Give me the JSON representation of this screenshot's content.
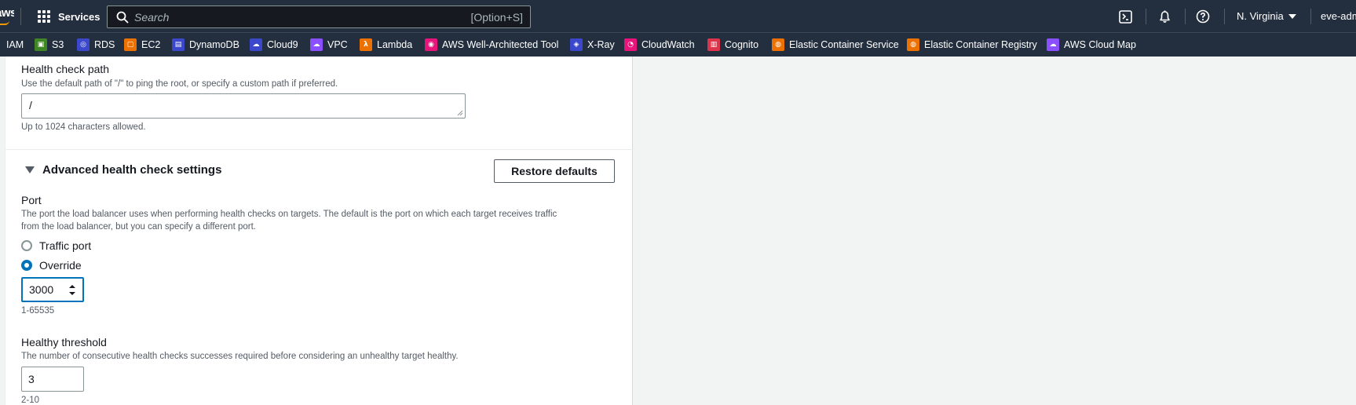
{
  "topnav": {
    "logo_text": "aws",
    "services_label": "Services",
    "search_placeholder": "Search",
    "search_shortcut": "[Option+S]",
    "region_label": "N. Virginia",
    "account_label": "eve-adm"
  },
  "favorites": [
    {
      "label": "IAM",
      "icon": "iam-icon",
      "color": "#dd344c"
    },
    {
      "label": "S3",
      "icon": "s3-icon",
      "color": "#3f8624"
    },
    {
      "label": "RDS",
      "icon": "rds-icon",
      "color": "#3b48cc"
    },
    {
      "label": "EC2",
      "icon": "ec2-icon",
      "color": "#ed7100"
    },
    {
      "label": "DynamoDB",
      "icon": "dynamodb-icon",
      "color": "#3b48cc"
    },
    {
      "label": "Cloud9",
      "icon": "cloud9-icon",
      "color": "#3b48cc"
    },
    {
      "label": "VPC",
      "icon": "vpc-icon",
      "color": "#8c4fff"
    },
    {
      "label": "Lambda",
      "icon": "lambda-icon",
      "color": "#ed7100"
    },
    {
      "label": "AWS Well-Architected Tool",
      "icon": "well-architected-icon",
      "color": "#e7157b"
    },
    {
      "label": "X-Ray",
      "icon": "xray-icon",
      "color": "#3b48cc"
    },
    {
      "label": "CloudWatch",
      "icon": "cloudwatch-icon",
      "color": "#e7157b"
    },
    {
      "label": "Cognito",
      "icon": "cognito-icon",
      "color": "#dd344c"
    },
    {
      "label": "Elastic Container Service",
      "icon": "ecs-icon",
      "color": "#ed7100"
    },
    {
      "label": "Elastic Container Registry",
      "icon": "ecr-icon",
      "color": "#ed7100"
    },
    {
      "label": "AWS Cloud Map",
      "icon": "cloud-map-icon",
      "color": "#8c4fff"
    }
  ],
  "health_check_path": {
    "label": "Health check path",
    "description": "Use the default path of \"/\" to ping the root, or specify a custom path if preferred.",
    "value": "/",
    "constraint": "Up to 1024 characters allowed."
  },
  "advanced": {
    "title": "Advanced health check settings",
    "restore_label": "Restore defaults"
  },
  "port": {
    "label": "Port",
    "description_line1": "The port the load balancer uses when performing health checks on targets. The default is the port on which each target receives traffic",
    "description_line2": "from the load balancer, but you can specify a different port.",
    "options": [
      {
        "label": "Traffic port",
        "checked": false
      },
      {
        "label": "Override",
        "checked": true
      }
    ],
    "value": "3000",
    "constraint": "1-65535"
  },
  "healthy_threshold": {
    "label": "Healthy threshold",
    "description": "The number of consecutive health checks successes required before considering an unhealthy target healthy.",
    "value": "3",
    "constraint": "2-10"
  },
  "colors": {
    "nav_bg": "#232f3e",
    "accent": "#0073bb",
    "page_bg": "#f2f3f3"
  }
}
